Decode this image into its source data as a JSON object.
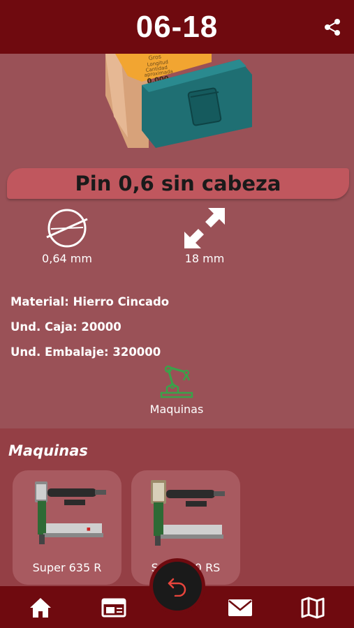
{
  "header": {
    "title": "06-18",
    "share_icon": "share-icon"
  },
  "product": {
    "name": "Pin 0,6 sin cabeza",
    "box_label_lines": [
      "Gros...",
      "Longitud",
      "Cantidad",
      "aproximada",
      "0.000"
    ],
    "diameter": "0,64 mm",
    "length": "18 mm",
    "material": "Material: Hierro Cincado",
    "units_box": "Und. Caja: 20000",
    "units_pack": "Und. Embalaje: 320000",
    "machines_link": "Maquinas"
  },
  "machines": {
    "title": "Maquinas",
    "items": [
      {
        "name": "Super 635 R"
      },
      {
        "name": "Super 50 RS"
      }
    ]
  },
  "nav": {
    "items": [
      "home-icon",
      "catalog-icon",
      "mail-icon",
      "map-icon"
    ],
    "back_icon": "undo-icon"
  },
  "colors": {
    "header": "#6f0a0f",
    "background": "#9a5157",
    "banner": "#c0575e",
    "accent_green": "#3aa24a",
    "fab_arrow": "#e8453c"
  }
}
